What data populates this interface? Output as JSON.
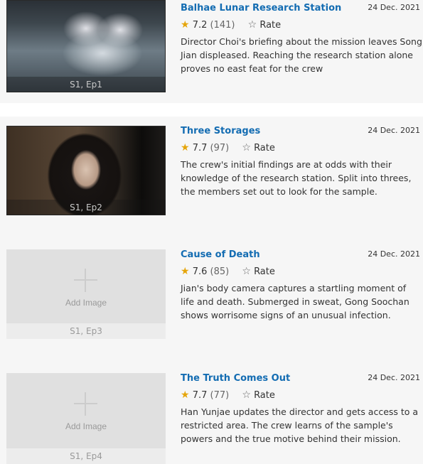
{
  "episodes": [
    {
      "title": "Balhae Lunar Research Station",
      "date": "24 Dec. 2021",
      "rating": "7.2",
      "votes": "(141)",
      "rate_label": "Rate",
      "plot": "Director Choi's briefing about the mission leaves Song Jian displeased. Reaching the research station alone proves no east feat for the crew",
      "ep_label": "S1, Ep1",
      "image": "photo"
    },
    {
      "title": "Three Storages",
      "date": "24 Dec. 2021",
      "rating": "7.7",
      "votes": "(97)",
      "rate_label": "Rate",
      "plot": "The crew's initial findings are at odds with their knowledge of the research station. Split into threes, the members set out to look for the sample.",
      "ep_label": "S1, Ep2",
      "image": "photo"
    },
    {
      "title": "Cause of Death",
      "date": "24 Dec. 2021",
      "rating": "7.6",
      "votes": "(85)",
      "rate_label": "Rate",
      "plot": "Jian's body camera captures a startling moment of life and death. Submerged in sweat, Gong Soochan shows worrisome signs of an unusual infection.",
      "ep_label": "S1, Ep3",
      "image": "placeholder",
      "add_image_label": "Add Image"
    },
    {
      "title": "The Truth Comes Out",
      "date": "24 Dec. 2021",
      "rating": "7.7",
      "votes": "(77)",
      "rate_label": "Rate",
      "plot": "Han Yunjae updates the director and gets access to a restricted area. The crew learns of the sample's powers and the true motive behind their mission.",
      "ep_label": "S1, Ep4",
      "image": "placeholder",
      "add_image_label": "Add Image"
    }
  ],
  "colors": {
    "title_link": "#136cb2",
    "star": "#e5a50a",
    "row_bg": "#f6f6f6",
    "placeholder_bg": "#e0e0e0"
  },
  "icons": {
    "rating": "star-filled-icon",
    "rate": "star-outline-icon",
    "add_image": "plus-icon"
  }
}
